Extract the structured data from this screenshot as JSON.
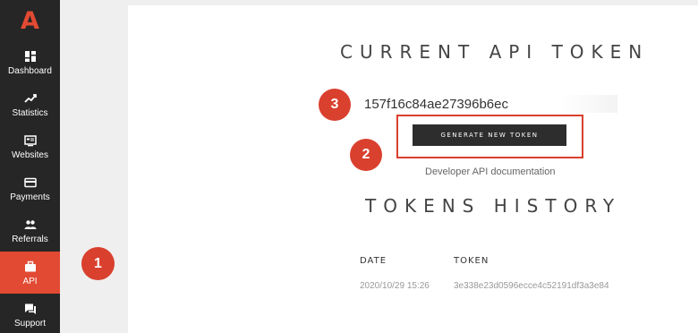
{
  "sidebar": {
    "logo": "A",
    "items": [
      {
        "label": "Dashboard",
        "icon": "dashboard-icon"
      },
      {
        "label": "Statistics",
        "icon": "statistics-icon"
      },
      {
        "label": "Websites",
        "icon": "websites-icon"
      },
      {
        "label": "Payments",
        "icon": "payments-icon"
      },
      {
        "label": "Referrals",
        "icon": "referrals-icon"
      },
      {
        "label": "API",
        "icon": "api-icon",
        "active": true
      },
      {
        "label": "Support",
        "icon": "support-icon"
      }
    ]
  },
  "current_token": {
    "title": "CURRENT API TOKEN",
    "value": "157f16c84ae27396b6ec",
    "generate_label": "GENERATE NEW TOKEN",
    "doc_link": "Developer API documentation"
  },
  "history": {
    "title": "TOKENS HISTORY",
    "columns": [
      "DATE",
      "TOKEN"
    ],
    "rows": [
      {
        "date": "2020/10/29 15:26",
        "token": "3e338e23d0596ecce4c52191df3a3e84"
      }
    ]
  },
  "callouts": [
    "1",
    "2",
    "3"
  ],
  "colors": {
    "accent": "#e24a33",
    "sidebar": "#262626",
    "button": "#2d2d2d"
  }
}
